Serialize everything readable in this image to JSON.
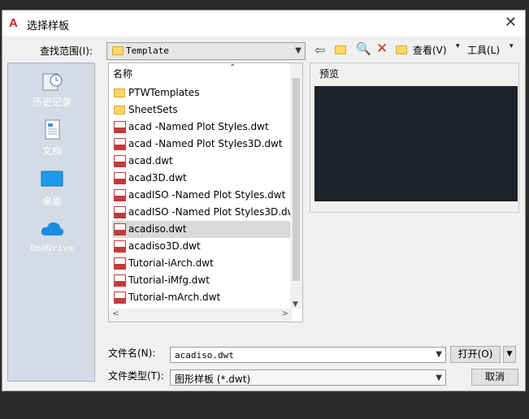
{
  "window": {
    "title": "选择样板",
    "close_symbol": "✕",
    "app_icon_letter": "A"
  },
  "lookin": {
    "label": "查找范围(I):",
    "value": "Template"
  },
  "toolbar": {
    "view_label": "查看(V)",
    "tools_label": "工具(L)"
  },
  "places": [
    {
      "label": "历史记录",
      "icon": "history-icon"
    },
    {
      "label": "文档",
      "icon": "documents-icon"
    },
    {
      "label": "桌面",
      "icon": "desktop-icon"
    },
    {
      "label": "OneDrive",
      "icon": "onedrive-icon"
    }
  ],
  "filelist": {
    "column_name": "名称",
    "items": [
      {
        "name": "PTWTemplates",
        "type": "folder"
      },
      {
        "name": "SheetSets",
        "type": "folder"
      },
      {
        "name": "acad -Named Plot Styles.dwt",
        "type": "dwt"
      },
      {
        "name": "acad -Named Plot Styles3D.dwt",
        "type": "dwt"
      },
      {
        "name": "acad.dwt",
        "type": "dwt"
      },
      {
        "name": "acad3D.dwt",
        "type": "dwt"
      },
      {
        "name": "acadISO -Named Plot Styles.dwt",
        "type": "dwt"
      },
      {
        "name": "acadISO -Named Plot Styles3D.dw",
        "type": "dwt"
      },
      {
        "name": "acadiso.dwt",
        "type": "dwt",
        "selected": true
      },
      {
        "name": "acadiso3D.dwt",
        "type": "dwt"
      },
      {
        "name": "Tutorial-iArch.dwt",
        "type": "dwt"
      },
      {
        "name": "Tutorial-iMfg.dwt",
        "type": "dwt"
      },
      {
        "name": "Tutorial-mArch.dwt",
        "type": "dwt"
      }
    ]
  },
  "preview": {
    "label": "预览"
  },
  "filename": {
    "label": "文件名(N):",
    "value": "acadiso.dwt"
  },
  "filetype": {
    "label": "文件类型(T):",
    "value": "图形样板 (*.dwt)"
  },
  "buttons": {
    "open": "打开(O)",
    "cancel": "取消"
  }
}
